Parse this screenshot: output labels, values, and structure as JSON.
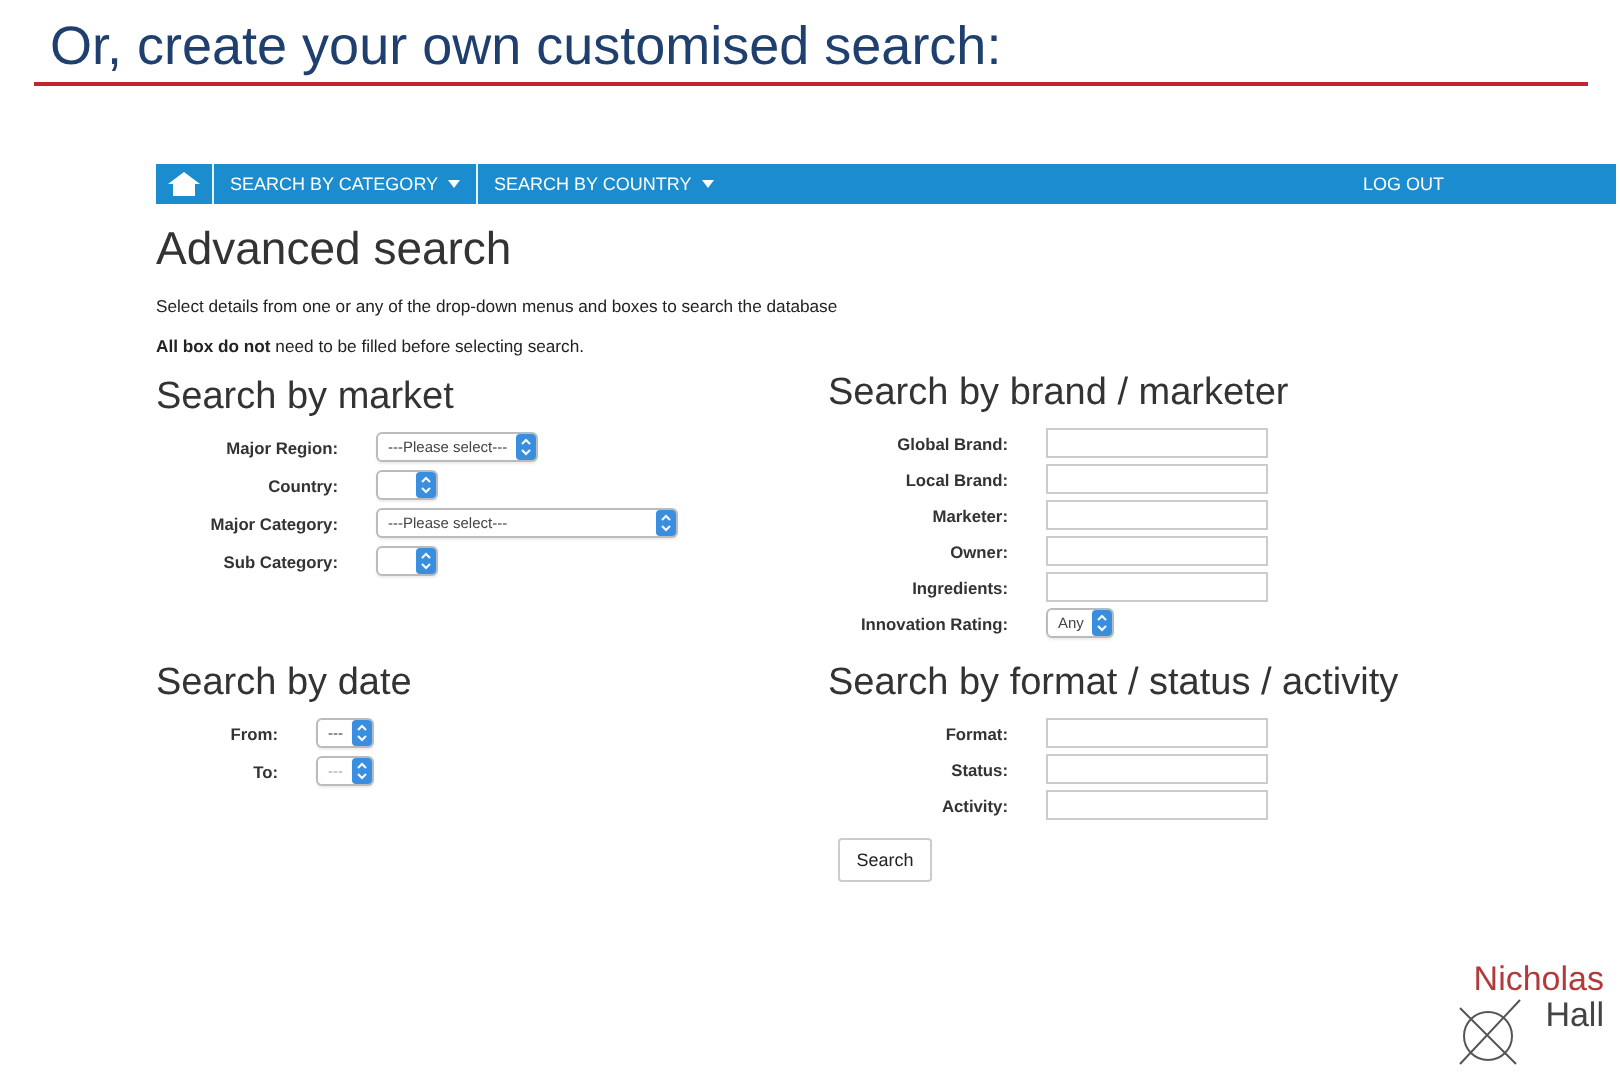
{
  "slide_title": "Or, create your own customised search:",
  "nav": {
    "menus": [
      {
        "label": "SEARCH BY CATEGORY",
        "dropdown": true
      },
      {
        "label": "SEARCH BY COUNTRY",
        "dropdown": true
      }
    ],
    "logout": "LOG OUT"
  },
  "page": {
    "title": "Advanced search",
    "notes": [
      "Select details from one or any of the drop-down menus and boxes to search the database",
      "**All box do not** need to be filled before selecting search."
    ]
  },
  "sections": [
    {
      "title": "Search by market",
      "fields": [
        {
          "label": "Major Region:",
          "kind": "select",
          "value": "---Please select---"
        },
        {
          "label": "Country:",
          "kind": "select"
        },
        {
          "label": "Major Category:",
          "kind": "select",
          "value": "---Please select---",
          "wide": true
        },
        {
          "label": "Sub Category:",
          "kind": "select"
        }
      ]
    },
    {
      "title": "Search by brand / marketer",
      "fields": [
        {
          "label": "Global Brand:",
          "kind": "text"
        },
        {
          "label": "Local Brand:",
          "kind": "text"
        },
        {
          "label": "Marketer:",
          "kind": "text"
        },
        {
          "label": "Owner:",
          "kind": "text"
        },
        {
          "label": "Ingredients:",
          "kind": "text"
        },
        {
          "label": "Innovation Rating:",
          "kind": "select",
          "value": "Any"
        }
      ]
    },
    {
      "title": "Search by date",
      "fields": [
        {
          "label": "From:",
          "kind": "select",
          "value": "---"
        },
        {
          "label": "To:",
          "kind": "select",
          "value": "---",
          "disabled": true
        }
      ]
    },
    {
      "title": "Search by format / status / activity",
      "fields": [
        {
          "label": "Format:",
          "kind": "text"
        },
        {
          "label": "Status:",
          "kind": "text"
        },
        {
          "label": "Activity:",
          "kind": "text"
        }
      ]
    }
  ],
  "search_button": "Search",
  "logo": {
    "line_1": "Nicholas",
    "line_2": "Hall"
  }
}
